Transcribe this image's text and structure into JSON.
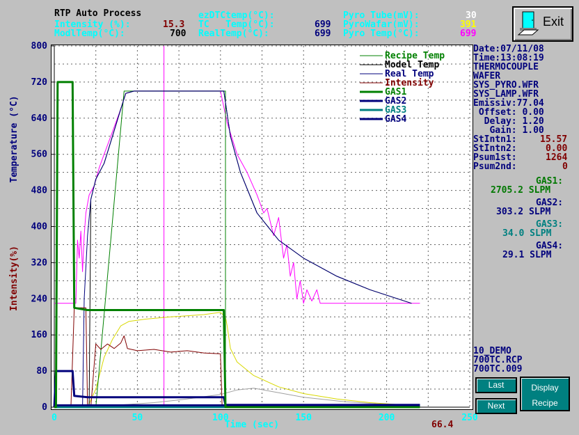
{
  "header": {
    "title": "RTP Auto Process",
    "intensity_label": "Intensity (%):",
    "intensity_value": "15.3",
    "modl_label": "ModlTemp(°C):",
    "modl_value": "700",
    "ezdtc_label": "ezDTCtemp(°C):",
    "tc_label": "TC   Temp(°C):",
    "tc_value": "699",
    "real_label": "RealTemp(°C):",
    "real_value": "699",
    "pyro_tube_label": "Pyro Tube(mV):",
    "pyro_tube_value": "30",
    "pyro_wafer_label": "PyroWafar(mV):",
    "pyro_wafer_value": "391",
    "pyro_temp_label": "Pyro Temp(°C):",
    "pyro_temp_value": "699"
  },
  "exit_label": "Exit",
  "info": {
    "date": "Date:07/11/08",
    "time": "Time:13:08:19",
    "line3": "THERMOCOUPLE",
    "line4": "WAFER",
    "line5": "SYS_PYRO.WFR",
    "line6": "SYS_LAMP.WFR",
    "emissiv": "Emissiv:77.04",
    "offset": " Offset: 0.00",
    "delay": "  Delay: 1.20",
    "gain": "   Gain: 1.00",
    "stintn1_label": "StIntn1:",
    "stintn1_value": "15.57",
    "stintn2_label": "StIntn2:",
    "stintn2_value": "0.00",
    "psum1_label": "Psum1st:",
    "psum1_value": "1264",
    "psum2_label": "Psum2nd:",
    "psum2_value": "0"
  },
  "gas": [
    {
      "label": "GAS1:",
      "value": "2705.2 SLPM",
      "color": "#007800"
    },
    {
      "label": "GAS2:",
      "value": "303.2 SLPM",
      "color": "#00007c"
    },
    {
      "label": "GAS3:",
      "value": "34.0 SLPM",
      "color": "#008080"
    },
    {
      "label": "GAS4:",
      "value": "29.1 SLPM",
      "color": "#00007c"
    }
  ],
  "files": {
    "line1": "10_DEMO",
    "line2": "700TC.RCP",
    "line3": "700TC.009"
  },
  "buttons": {
    "last": "Last",
    "next": "Next",
    "display_line1": "Display",
    "display_line2": "Recipe"
  },
  "status_value": "66.4",
  "chart_data": {
    "type": "line",
    "xlabel": "Time (sec)",
    "ylabel": "Temperature (°C)",
    "ylabel2": "Intensity(%)",
    "xlim": [
      0,
      250
    ],
    "ylim": [
      0,
      800
    ],
    "x_ticks": [
      0,
      50,
      100,
      150,
      200,
      250
    ],
    "y_ticks": [
      0,
      80,
      160,
      240,
      320,
      400,
      480,
      560,
      640,
      720,
      800
    ],
    "grid": true,
    "legend_position": "top-right",
    "series": [
      {
        "name": "Recipe Temp",
        "color": "#008000",
        "width": 1,
        "points": [
          [
            0,
            0
          ],
          [
            25,
            0
          ],
          [
            42,
            700
          ],
          [
            103,
            700
          ],
          [
            103,
            0
          ]
        ]
      },
      {
        "name": "Model Temp",
        "color": "#000000",
        "width": 1,
        "points": [
          [
            0,
            0
          ],
          [
            21,
            0
          ],
          [
            22,
            460
          ],
          [
            25,
            505
          ],
          [
            30,
            540
          ],
          [
            35,
            600
          ],
          [
            40,
            660
          ],
          [
            43,
            695
          ],
          [
            48,
            700
          ],
          [
            102,
            700
          ],
          [
            106,
            600
          ],
          [
            112,
            520
          ],
          [
            122,
            430
          ],
          [
            135,
            370
          ],
          [
            150,
            330
          ],
          [
            170,
            290
          ],
          [
            190,
            260
          ],
          [
            215,
            230
          ]
        ]
      },
      {
        "name": "Real Temp",
        "color": "#00007c",
        "width": 1,
        "points": [
          [
            0,
            0
          ],
          [
            17,
            0
          ],
          [
            18,
            240
          ],
          [
            20,
            380
          ],
          [
            22,
            460
          ],
          [
            25,
            505
          ],
          [
            30,
            540
          ],
          [
            35,
            600
          ],
          [
            40,
            660
          ],
          [
            43,
            695
          ],
          [
            48,
            700
          ],
          [
            102,
            700
          ],
          [
            106,
            600
          ],
          [
            112,
            520
          ],
          [
            122,
            430
          ],
          [
            135,
            370
          ],
          [
            150,
            330
          ],
          [
            170,
            290
          ],
          [
            190,
            260
          ],
          [
            215,
            230
          ]
        ]
      },
      {
        "name": "Intensity",
        "color": "#800000",
        "width": 1,
        "points": [
          [
            0,
            0
          ],
          [
            10,
            0
          ],
          [
            12,
            220
          ],
          [
            19,
            220
          ],
          [
            20,
            0
          ],
          [
            22,
            0
          ],
          [
            25,
            140
          ],
          [
            28,
            128
          ],
          [
            32,
            140
          ],
          [
            36,
            130
          ],
          [
            40,
            142
          ],
          [
            42,
            158
          ],
          [
            44,
            130
          ],
          [
            50,
            125
          ],
          [
            60,
            128
          ],
          [
            70,
            122
          ],
          [
            80,
            125
          ],
          [
            90,
            120
          ],
          [
            100,
            118
          ],
          [
            101,
            0
          ]
        ]
      },
      {
        "name": "GAS1",
        "color": "#008000",
        "width": 3,
        "points": [
          [
            0,
            0
          ],
          [
            1,
            0
          ],
          [
            2,
            720
          ],
          [
            11,
            720
          ],
          [
            12,
            220
          ],
          [
            20,
            215
          ],
          [
            102,
            215
          ],
          [
            103,
            0
          ],
          [
            220,
            0
          ]
        ]
      },
      {
        "name": "GAS2",
        "color": "#00007c",
        "width": 3,
        "points": [
          [
            0,
            0
          ],
          [
            1,
            80
          ],
          [
            11,
            80
          ],
          [
            12,
            25
          ],
          [
            20,
            22
          ],
          [
            102,
            22
          ],
          [
            103,
            5
          ],
          [
            220,
            5
          ]
        ]
      },
      {
        "name": "GAS3",
        "color": "#008080",
        "width": 3,
        "points": [
          [
            0,
            0
          ],
          [
            103,
            0
          ],
          [
            104,
            3
          ],
          [
            220,
            3
          ]
        ]
      },
      {
        "name": "GAS4",
        "color": "#00007c",
        "width": 3,
        "points": [
          [
            0,
            4
          ],
          [
            220,
            4
          ]
        ]
      },
      {
        "name": "",
        "color": "#ff00ff",
        "width": 1,
        "points": [
          [
            0,
            230
          ],
          [
            13,
            230
          ],
          [
            14,
            370
          ],
          [
            15,
            330
          ],
          [
            16,
            390
          ],
          [
            17,
            300
          ],
          [
            18,
            380
          ],
          [
            19,
            430
          ],
          [
            21,
            470
          ],
          [
            24,
            490
          ],
          [
            27,
            530
          ],
          [
            30,
            560
          ],
          [
            35,
            610
          ],
          [
            40,
            660
          ],
          [
            43,
            695
          ],
          [
            48,
            700
          ],
          [
            100,
            700
          ],
          [
            104,
            630
          ],
          [
            110,
            560
          ],
          [
            116,
            520
          ],
          [
            122,
            470
          ],
          [
            126,
            430
          ],
          [
            128,
            440
          ],
          [
            132,
            380
          ],
          [
            135,
            420
          ],
          [
            138,
            330
          ],
          [
            140,
            360
          ],
          [
            142,
            290
          ],
          [
            144,
            320
          ],
          [
            146,
            240
          ],
          [
            148,
            280
          ],
          [
            150,
            230
          ],
          [
            152,
            260
          ],
          [
            155,
            235
          ],
          [
            158,
            260
          ],
          [
            160,
            230
          ],
          [
            220,
            230
          ]
        ]
      },
      {
        "name": "",
        "color": "#d8d800",
        "width": 1,
        "points": [
          [
            0,
            0
          ],
          [
            20,
            0
          ],
          [
            25,
            40
          ],
          [
            30,
            110
          ],
          [
            35,
            150
          ],
          [
            40,
            180
          ],
          [
            45,
            190
          ],
          [
            55,
            195
          ],
          [
            70,
            200
          ],
          [
            90,
            205
          ],
          [
            100,
            210
          ],
          [
            103,
            200
          ],
          [
            104,
            180
          ],
          [
            106,
            130
          ],
          [
            110,
            100
          ],
          [
            120,
            70
          ],
          [
            135,
            45
          ],
          [
            150,
            30
          ],
          [
            170,
            18
          ],
          [
            190,
            10
          ],
          [
            210,
            5
          ]
        ]
      },
      {
        "name": "",
        "color": "#a0a0a0",
        "width": 1,
        "points": [
          [
            0,
            0
          ],
          [
            40,
            5
          ],
          [
            60,
            10
          ],
          [
            80,
            18
          ],
          [
            100,
            28
          ],
          [
            110,
            38
          ],
          [
            120,
            42
          ],
          [
            135,
            32
          ],
          [
            150,
            22
          ],
          [
            175,
            12
          ],
          [
            200,
            6
          ],
          [
            220,
            3
          ]
        ]
      }
    ],
    "vlines": [
      {
        "x": 66,
        "color": "#ff00ff"
      }
    ]
  }
}
